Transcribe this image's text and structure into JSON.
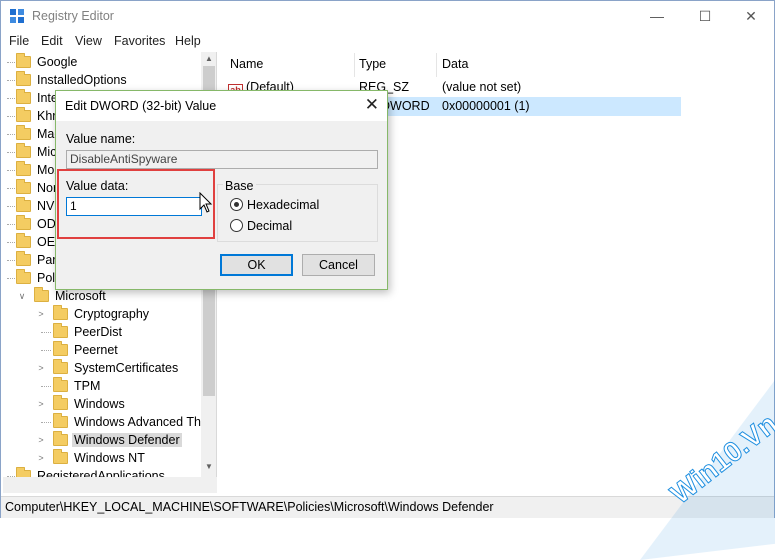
{
  "window": {
    "title": "Registry Editor",
    "controls": {
      "minimize": "—",
      "maximize": "☐",
      "close": "✕"
    }
  },
  "menu": {
    "file": "File",
    "edit": "Edit",
    "view": "View",
    "favorites": "Favorites",
    "help": "Help"
  },
  "tree": {
    "items": [
      {
        "label": "Google",
        "expander": ""
      },
      {
        "label": "InstalledOptions",
        "expander": ""
      },
      {
        "label": "Intel",
        "expander": ""
      },
      {
        "label": "Khro",
        "expander": ""
      },
      {
        "label": "Mac",
        "expander": ""
      },
      {
        "label": "Micr",
        "expander": ""
      },
      {
        "label": "Moz",
        "expander": ""
      },
      {
        "label": "Nort",
        "expander": ""
      },
      {
        "label": "NVID",
        "expander": ""
      },
      {
        "label": "ODE",
        "expander": ""
      },
      {
        "label": "OEM",
        "expander": ""
      },
      {
        "label": "Part",
        "expander": ""
      },
      {
        "label": "Polic",
        "expander": ""
      },
      {
        "label": "Microsoft",
        "expander": "∨"
      },
      {
        "label": "Cryptography",
        "expander": ">"
      },
      {
        "label": "PeerDist",
        "expander": ""
      },
      {
        "label": "Peernet",
        "expander": ""
      },
      {
        "label": "SystemCertificates",
        "expander": ">"
      },
      {
        "label": "TPM",
        "expander": ""
      },
      {
        "label": "Windows",
        "expander": ">"
      },
      {
        "label": "Windows Advanced Thr",
        "expander": ""
      },
      {
        "label": "Windows Defender",
        "expander": ">"
      },
      {
        "label": "Windows NT",
        "expander": ">"
      },
      {
        "label": "RegisteredApplications",
        "expander": ""
      }
    ]
  },
  "list": {
    "headers": {
      "name": "Name",
      "type": "Type",
      "data": "Data"
    },
    "rows": [
      {
        "name": "(Default)",
        "icon": "ab",
        "type": "REG_SZ",
        "data": "(value not set)"
      },
      {
        "name": "",
        "icon": "",
        "type": "DWORD",
        "data": "0x00000001 (1)"
      }
    ]
  },
  "status": {
    "path": "Computer\\HKEY_LOCAL_MACHINE\\SOFTWARE\\Policies\\Microsoft\\Windows Defender"
  },
  "dialog": {
    "title": "Edit DWORD (32-bit) Value",
    "close": "✕",
    "value_name_label": "Value name:",
    "value_name": "DisableAntiSpyware",
    "value_data_label": "Value data:",
    "value_data": "1",
    "base_label": "Base",
    "hex_label": "Hexadecimal",
    "dec_label": "Decimal",
    "ok": "OK",
    "cancel": "Cancel"
  },
  "watermark": "Win10.Vn",
  "colors": {
    "selection": "#cce8ff",
    "highlight": "#e0403f",
    "watermark": "#1f8fe0"
  }
}
